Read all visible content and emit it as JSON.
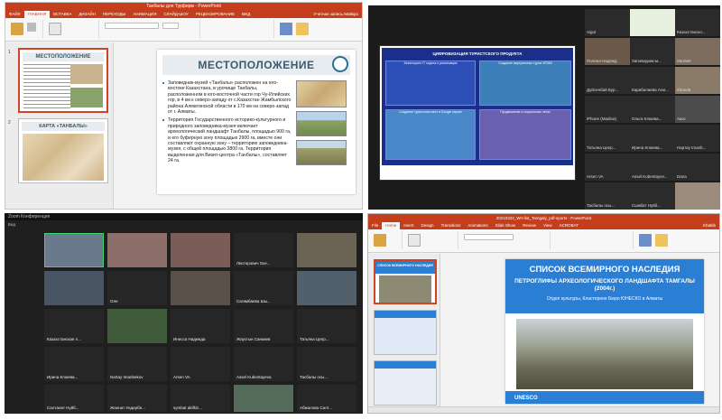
{
  "panel1": {
    "title": "Танбалы для Турфирм - PowerPoint",
    "tabs": [
      "ФАЙЛ",
      "ГЛАВНАЯ",
      "ВСТАВКА",
      "ДИЗАЙН",
      "ПЕРЕХОДЫ",
      "АНИМАЦИЯ",
      "СЛАЙД-ШОУ",
      "РЕЦЕНЗИРОВАНИЕ",
      "ВИД"
    ],
    "account": "Учетная запись Майкро",
    "thumbs": [
      {
        "num": "1",
        "title": "МЕСТОПОЛОЖЕНИЕ"
      },
      {
        "num": "2",
        "title": "КАРТА «ТАНБАЛЫ»"
      }
    ],
    "slide": {
      "title": "МЕСТОПОЛОЖЕНИЕ",
      "bullets": [
        "Заповедник-музей «Танбалы» расположен на юго-востоке Казахстана, в урочище Танбалы, расположенном в юго-восточной части гор Чу-Илийских гор, в 4 км к северо-западу от с.Казахстан Жамбылского района Алматинской области в 170 км на северо-запад от г. Алматы.",
        "Территория Государственного историко-культурного и природного заповедника-музея включает археологический ландшафт Танбалы, площадью 900 га, и его буферную зону площадью 2900 га, вместе они составляют охранную зону – территорию заповедника-музея, с общей площадью 3800 га. Территория выделенная для Визит-центра «Танбалы», составляет 24 га."
      ]
    }
  },
  "panel2": {
    "banner_title": "ЦИФРОВИЗАЦИЯ ТУРИСТСКОГО ПРОДУКТА",
    "cells": [
      "Мониторинг IT отдела и реализация",
      "Создание виртуальных туров VR360",
      "Создание туристских мест в Google картах",
      "Продвижение в социальных сетях"
    ],
    "participants": [
      "Aigul",
      "",
      "Казахстанско...",
      "Полина Надежд",
      "Заповедник-м...",
      "Матвея",
      "Дуйсенбай Бур...",
      "Карабалаева Али...",
      "Zhanda",
      "iPhone (Madina)",
      "Ольга Клюева...",
      "Акос",
      "Татьяна Цепр...",
      "Ирина Клюева...",
      "Нартау Imanb...",
      "Arsen VA",
      "Assel Kubentayev...",
      "Dana",
      "Тасбалы осы...",
      "Сымбат Нуйб...",
      ""
    ]
  },
  "panel3": {
    "window_title": "Zoom Конференция",
    "view_label": "Вид",
    "participants": [
      "",
      "",
      "",
      "Листерович Оке...",
      "",
      "",
      "Оле",
      "",
      "Сагимбаева Шы...",
      "",
      "Казахстанская л...",
      "",
      "Инесса Надежда",
      "Жаусгын Санкиев",
      "Татьяна Цепр...",
      "Ирина Клюева...",
      "Nartay Imanbekov",
      "Arsen VA",
      "Assel Kubentayeva",
      "Тасбалы осы...",
      "Салтанат Нуйб...",
      "Жаннат Ундербе...",
      "symbat akifkiz...",
      "",
      "Абжалова Салт..."
    ]
  },
  "panel4": {
    "title": "20210322_WH list_Tamgaly_pdf-sports - PowerPoint",
    "tabs": [
      "File",
      "Home",
      "Insert",
      "Design",
      "Transitions",
      "Animations",
      "Slide Show",
      "Review",
      "View",
      "ACROBAT"
    ],
    "account": "Khabib",
    "thumb_title": "СПИСОК ВСЕМИРНОГО НАСЛЕДИЯ",
    "slide": {
      "heading": "СПИСОК ВСЕМИРНОГО НАСЛЕДИЯ",
      "subheading": "ПЕТРОГЛИФЫ АРХЕОЛОГИЧЕСКОГО ЛАНДШАФТА ТАМГАЛЫ (2004г.)",
      "caption": "Отдел культуры, Кластерное Бюро ЮНЕСКО в Алматы",
      "footer": "UNESCO"
    }
  }
}
